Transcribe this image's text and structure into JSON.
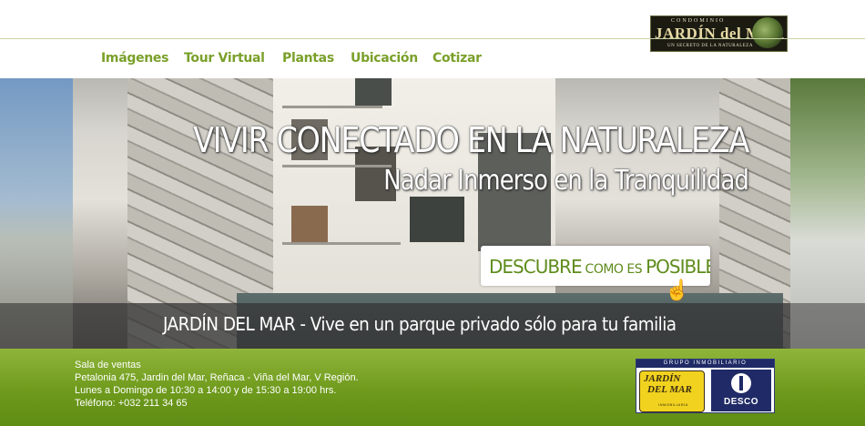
{
  "header": {
    "logo": {
      "top_text": "CONDOMINIO",
      "main_text": "JARDÍN del MAR",
      "sub_text": "UN SECRETO DE LA NATURALEZA"
    },
    "nav": [
      {
        "label": "Imágenes"
      },
      {
        "label": "Tour Virtual"
      },
      {
        "label": "Plantas"
      },
      {
        "label": "Ubicación"
      },
      {
        "label": "Cotizar"
      }
    ]
  },
  "hero": {
    "title": "VIVIR CONECTADO EN LA NATURALEZA",
    "subtitle": "Nadar Inmerso en la Tranquilidad",
    "cta": {
      "part1": "DESCUBRE",
      "part2": " COMO ES ",
      "part3": "POSIBLE"
    },
    "banner": "JARDÍN DEL MAR - Vive en un parque privado sólo para tu familia"
  },
  "footer": {
    "lines": [
      "Sala de ventas",
      "Petalonia 475, Jardin del Mar, Reñaca - Viña del Mar, V Región.",
      "Lunes a Domingo de 10:30 a 14:00 y de 15:30 a 19:00 hrs.",
      "Teléfono: +032 211 34 65"
    ],
    "partners": {
      "heading": "GRUPO INMOBILIARIO",
      "logo1_line1": "JARDÍN",
      "logo1_line2": "DEL MAR",
      "logo1_sub": "INMOBILIARIA",
      "logo2": "DESCO"
    }
  },
  "colors": {
    "nav": "#7aa02a",
    "footer_green": "#6e9a1c",
    "cta_green": "#5f8c1c",
    "partner_blue": "#1f2a66"
  }
}
